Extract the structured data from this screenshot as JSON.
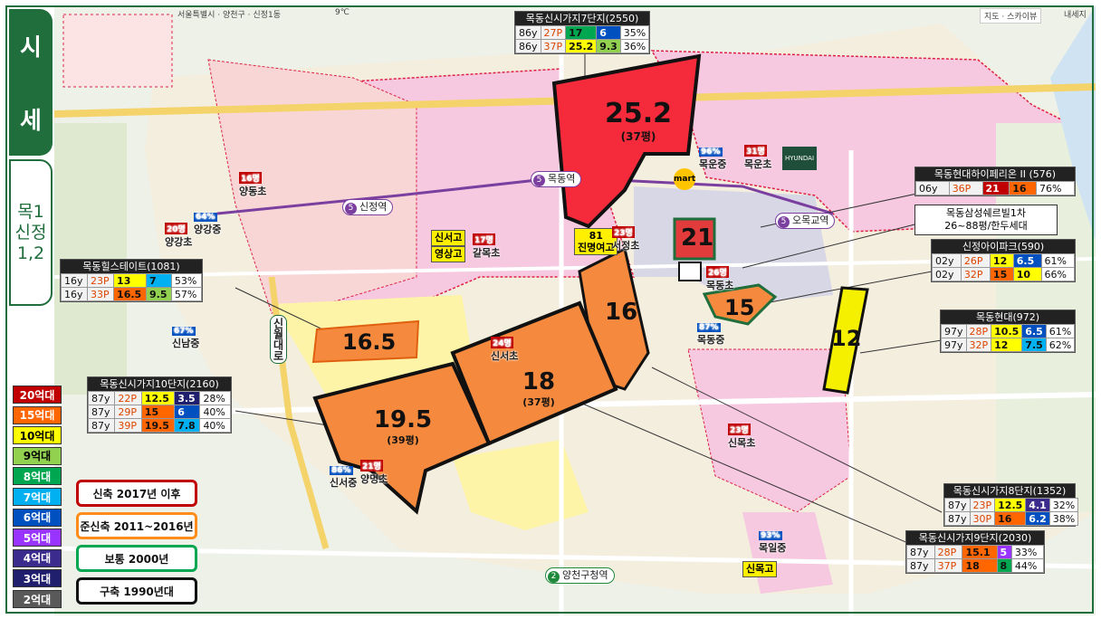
{
  "side_tabs": {
    "price_line1": "시",
    "price_line2": "세",
    "area_line1": "목1",
    "area_line2": "신정",
    "area_line3": "1,2"
  },
  "price_legend": [
    {
      "label": "20억대",
      "color": "#c00000"
    },
    {
      "label": "15억대",
      "color": "#ff6600"
    },
    {
      "label": "10억대",
      "color": "#ffff00",
      "text_color": "#000"
    },
    {
      "label": "9억대",
      "color": "#92d050",
      "text_color": "#000"
    },
    {
      "label": "8억대",
      "color": "#00a650"
    },
    {
      "label": "7억대",
      "color": "#00b0f0"
    },
    {
      "label": "6억대",
      "color": "#0050c0"
    },
    {
      "label": "5억대",
      "color": "#9933ff"
    },
    {
      "label": "4억대",
      "color": "#3b2b8c"
    },
    {
      "label": "3억대",
      "color": "#1f1f6e"
    },
    {
      "label": "2억대",
      "color": "#595959"
    }
  ],
  "era_legend": [
    {
      "label": "신축 2017년 이후",
      "color": "#c00000"
    },
    {
      "label": "준신축 2011~2016년",
      "color": "#ff8c1a"
    },
    {
      "label": "보통 2000년",
      "color": "#00a650"
    },
    {
      "label": "구축 1990년대",
      "color": "#111111"
    }
  ],
  "complexes": [
    {
      "title": "목동신시가지7단지(2550)",
      "rows": [
        {
          "age": "86y",
          "size": "27P",
          "price": "17",
          "jeonse": "6",
          "ratio": "35%",
          "price_color": "#00a650",
          "jeonse_color": "#0050c0"
        },
        {
          "age": "86y",
          "size": "37P",
          "price": "25.2",
          "jeonse": "9.3",
          "ratio": "36%",
          "price_color": "#ffff00",
          "jeonse_color": "#92d050"
        }
      ]
    },
    {
      "title": "목동현대하이페리온 II (576)",
      "rows": [
        {
          "age": "06y",
          "size": "36P",
          "price": "21",
          "jeonse": "16",
          "ratio": "76%",
          "price_color": "#c00000",
          "jeonse_color": "#ff6600"
        }
      ]
    },
    {
      "title": "신정아이파크(590)",
      "rows": [
        {
          "age": "02y",
          "size": "26P",
          "price": "12",
          "jeonse": "6.5",
          "ratio": "61%",
          "price_color": "#ffff00",
          "jeonse_color": "#0050c0"
        },
        {
          "age": "02y",
          "size": "32P",
          "price": "15",
          "jeonse": "10",
          "ratio": "66%",
          "price_color": "#ff6600",
          "jeonse_color": "#ffff00"
        }
      ]
    },
    {
      "title": "목동힐스테이트(1081)",
      "rows": [
        {
          "age": "16y",
          "size": "23P",
          "price": "13",
          "jeonse": "7",
          "ratio": "53%",
          "price_color": "#ffff00",
          "jeonse_color": "#00b0f0"
        },
        {
          "age": "16y",
          "size": "33P",
          "price": "16.5",
          "jeonse": "9.5",
          "ratio": "57%",
          "price_color": "#ff6600",
          "jeonse_color": "#92d050"
        }
      ]
    },
    {
      "title": "목동현대(972)",
      "rows": [
        {
          "age": "97y",
          "size": "28P",
          "price": "10.5",
          "jeonse": "6.5",
          "ratio": "61%",
          "price_color": "#ffff00",
          "jeonse_color": "#0050c0"
        },
        {
          "age": "97y",
          "size": "32P",
          "price": "12",
          "jeonse": "7.5",
          "ratio": "62%",
          "price_color": "#ffff00",
          "jeonse_color": "#00b0f0"
        }
      ]
    },
    {
      "title": "목동신시가지10단지(2160)",
      "rows": [
        {
          "age": "87y",
          "size": "22P",
          "price": "12.5",
          "jeonse": "3.5",
          "ratio": "28%",
          "price_color": "#ffff00",
          "jeonse_color": "#1f1f6e"
        },
        {
          "age": "87y",
          "size": "29P",
          "price": "15",
          "jeonse": "6",
          "ratio": "40%",
          "price_color": "#ff6600",
          "jeonse_color": "#0050c0"
        },
        {
          "age": "87y",
          "size": "39P",
          "price": "19.5",
          "jeonse": "7.8",
          "ratio": "40%",
          "price_color": "#ff6600",
          "jeonse_color": "#00b0f0"
        }
      ]
    },
    {
      "title": "목동신시가지8단지(1352)",
      "rows": [
        {
          "age": "87y",
          "size": "23P",
          "price": "12.5",
          "jeonse": "4.1",
          "ratio": "32%",
          "price_color": "#ffff00",
          "jeonse_color": "#3b2b8c"
        },
        {
          "age": "87y",
          "size": "30P",
          "price": "16",
          "jeonse": "6.2",
          "ratio": "38%",
          "price_color": "#ff6600",
          "jeonse_color": "#0050c0"
        }
      ]
    },
    {
      "title": "목동신시가지9단지(2030)",
      "rows": [
        {
          "age": "87y",
          "size": "28P",
          "price": "15.1",
          "jeonse": "5",
          "ratio": "33%",
          "price_color": "#ff6600",
          "jeonse_color": "#9933ff"
        },
        {
          "age": "87y",
          "size": "37P",
          "price": "18",
          "jeonse": "8",
          "ratio": "44%",
          "price_color": "#ff6600",
          "jeonse_color": "#00a650"
        }
      ]
    }
  ],
  "callout_samsung": {
    "line1": "목동삼성쉐르빌1차",
    "line2": "26~88평/한두세대"
  },
  "parcels": {
    "p7": {
      "value": "25.2",
      "size": "(37평)"
    },
    "p16": {
      "value": "16"
    },
    "p18": {
      "value": "18",
      "size": "(37평)"
    },
    "p195": {
      "value": "19.5",
      "size": "(39평)"
    },
    "p165": {
      "value": "16.5"
    },
    "p21": {
      "value": "21"
    },
    "p15": {
      "value": "15"
    },
    "p12": {
      "value": "12"
    }
  },
  "stations": [
    {
      "num": "5",
      "name": "목동역"
    },
    {
      "num": "5",
      "name": "신정역"
    },
    {
      "num": "5",
      "name": "오목교역"
    },
    {
      "num": "2",
      "name": "양천구청역"
    }
  ],
  "schools": [
    {
      "name": "양동초",
      "count": "16명"
    },
    {
      "name": "양강초",
      "count": "20명"
    },
    {
      "name": "양강중",
      "pct": "64%"
    },
    {
      "name": "신서고",
      "hs": true
    },
    {
      "name": "영상고",
      "hs": true
    },
    {
      "name": "갈목초",
      "count": "17명"
    },
    {
      "name": "진명여고",
      "count": "81"
    },
    {
      "name": "서정초",
      "count": "23명"
    },
    {
      "name": "목운중",
      "pct": "96%"
    },
    {
      "name": "목운초",
      "count": "31명"
    },
    {
      "name": "목동초",
      "count": "26명"
    },
    {
      "name": "목동중",
      "pct": "87%"
    },
    {
      "name": "신남중",
      "pct": "67%"
    },
    {
      "name": "신서초",
      "count": "24명"
    },
    {
      "name": "신서중",
      "pct": "86%"
    },
    {
      "name": "양명초",
      "count": "21명"
    },
    {
      "name": "신목초",
      "count": "23명"
    },
    {
      "name": "목일중",
      "pct": "93%"
    },
    {
      "name": "신목고",
      "hs": true
    }
  ],
  "map_labels": {
    "road_name": "신월대로",
    "top_bar": "서울특별시 · 양천구 · 신정1동",
    "temp": "9℃",
    "map_control": "지도 · 스카이뷰",
    "map_store": "mart",
    "brand": "HYUNDAI",
    "corner_button": "내세지"
  }
}
